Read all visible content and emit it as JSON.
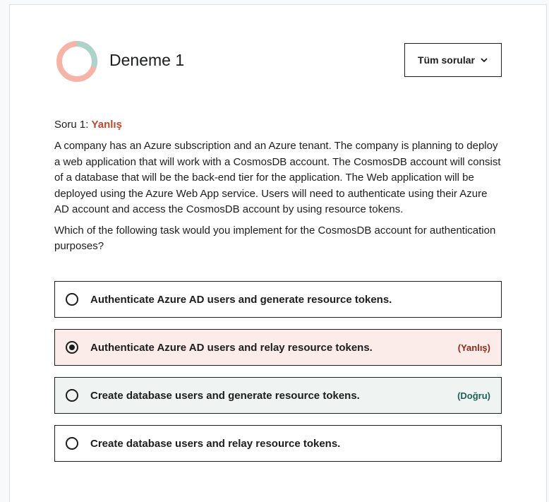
{
  "colors": {
    "donut_correct": "#acd2cc",
    "donut_incorrect": "#f5b4a6",
    "incorrect_text": "#c4442f",
    "wrong_option_bg": "#fbecea",
    "correct_option_bg": "#eff4f2",
    "correct_tag_color": "#1e6055",
    "wrong_tag_color": "#8e2a18"
  },
  "header": {
    "title": "Deneme 1",
    "filter_label": "Tüm sorular",
    "filter_icon": "chevron-down-icon",
    "score_donut": {
      "correct_fraction": 0.3,
      "incorrect_fraction": 0.7
    }
  },
  "question": {
    "number_label": "Soru 1:",
    "result": "Yanlış",
    "body": "A company has an Azure subscription and an Azure tenant. The company is planning to deploy a web application that will work with a CosmosDB account. The CosmosDB account will consist of a database that will be the back-end tier for the application. The Web application will be deployed using the Azure Web App service. Users will need to authenticate using their Azure AD account and access the CosmosDB account by using resource tokens.",
    "prompt": "Which of the following task would you implement for the CosmosDB account for authentication purposes?",
    "options": [
      {
        "label": "Authenticate Azure AD users and generate resource tokens.",
        "tag": "",
        "selected": false
      },
      {
        "label": "Authenticate Azure AD users and relay resource tokens.",
        "tag": "(Yanlış)",
        "selected": true
      },
      {
        "label": "Create database users and generate resource tokens.",
        "tag": "(Doğru)",
        "selected": false
      },
      {
        "label": "Create database users and relay resource tokens.",
        "tag": "",
        "selected": false
      }
    ]
  }
}
